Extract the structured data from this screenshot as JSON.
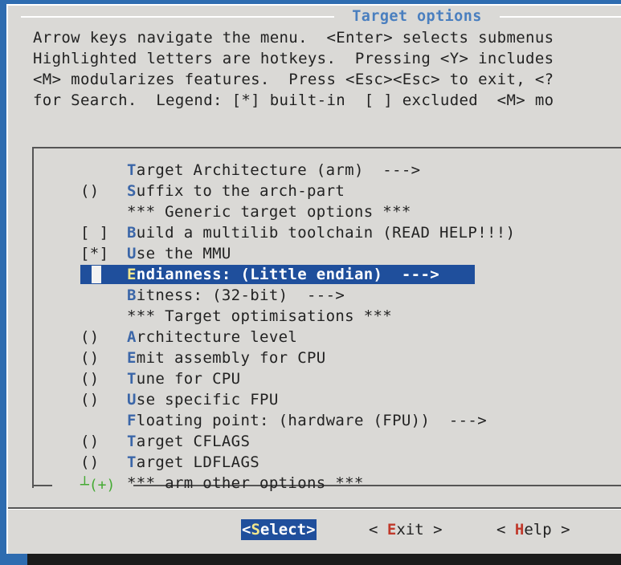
{
  "title": "Target options",
  "help_lines": [
    "Arrow keys navigate the menu.  <Enter> selects submenus",
    "Highlighted letters are hotkeys.  Pressing <Y> includes",
    "<M> modularizes features.  Press <Esc><Esc> to exit, <?",
    "for Search.  Legend: [*] built-in  [ ] excluded  <M> mo"
  ],
  "menu": [
    {
      "prefix": "",
      "hot": "T",
      "rest": "arget Architecture (arm)  --->"
    },
    {
      "prefix": "()",
      "hot": "S",
      "rest": "uffix to the arch-part"
    },
    {
      "prefix": "",
      "hot": "",
      "rest": "*** Generic target options ***"
    },
    {
      "prefix": "[ ]",
      "hot": "B",
      "rest": "uild a multilib toolchain (READ HELP!!!)"
    },
    {
      "prefix": "[*]",
      "hot": "U",
      "rest": "se the MMU"
    },
    {
      "prefix": "",
      "hot": "E",
      "rest": "ndianness: (Little endian)  --->",
      "selected": true
    },
    {
      "prefix": "",
      "hot": "B",
      "rest": "itness: (32-bit)  --->"
    },
    {
      "prefix": "",
      "hot": "",
      "rest": "*** Target optimisations ***"
    },
    {
      "prefix": "()",
      "hot": "A",
      "rest": "rchitecture level"
    },
    {
      "prefix": "()",
      "hot": "E",
      "rest": "mit assembly for CPU"
    },
    {
      "prefix": "()",
      "hot": "T",
      "rest": "une for CPU"
    },
    {
      "prefix": "()",
      "hot": "U",
      "rest": "se specific FPU"
    },
    {
      "prefix": "",
      "hot": "F",
      "rest": "loating point: (hardware (FPU))  --->"
    },
    {
      "prefix": "()",
      "hot": "T",
      "rest": "arget CFLAGS"
    },
    {
      "prefix": "()",
      "hot": "T",
      "rest": "arget LDFLAGS"
    },
    {
      "prefix": "",
      "hot": "",
      "rest": "*** arm other options ***"
    }
  ],
  "more_indicator": "┴(+)",
  "buttons": {
    "select": {
      "open": "<",
      "hot": "S",
      "rest": "elect>"
    },
    "exit": {
      "open": "< ",
      "hot": "E",
      "rest": "xit >"
    },
    "help": {
      "open": "< ",
      "hot": "H",
      "rest": "elp >"
    }
  },
  "colors": {
    "background": "#2e6cb0",
    "dialog": "#dad9d6",
    "selection": "#1f4f9c",
    "hotkey": "#3b66a8",
    "button_hotkey": "#c0392b"
  }
}
